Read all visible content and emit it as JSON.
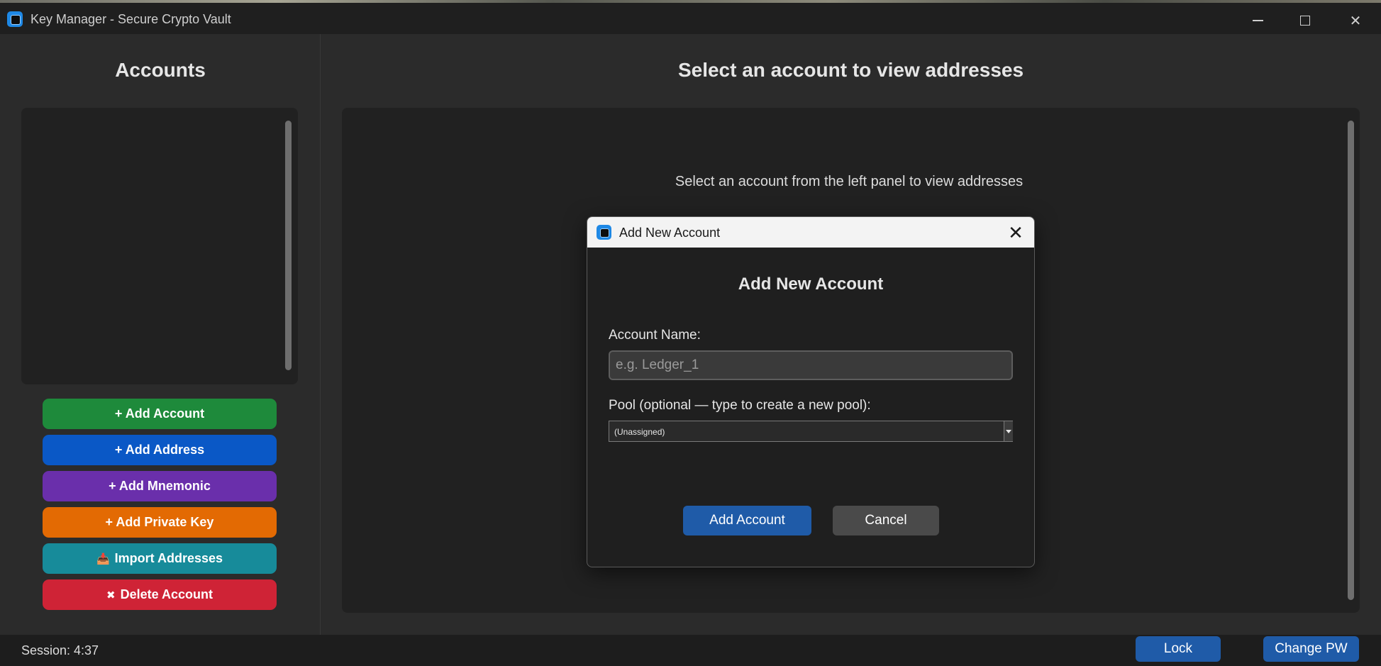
{
  "window": {
    "title": "Key Manager - Secure Crypto Vault",
    "minimize_glyph": "—",
    "maximize_glyph": "☐",
    "close_glyph": "✕"
  },
  "sidebar": {
    "title": "Accounts",
    "buttons": {
      "add_account": "+ Add Account",
      "add_address": "+ Add Address",
      "add_mnemonic": "+ Add Mnemonic",
      "add_private_key": "+ Add Private Key",
      "import_addresses": "Import Addresses",
      "import_icon_glyph": "📥",
      "delete_account": "Delete Account",
      "delete_icon_glyph": "✖"
    }
  },
  "main": {
    "title": "Select an account to view addresses",
    "hint": "Select an account from the left panel to view addresses"
  },
  "status": {
    "session": "Session: 4:37",
    "lock": "Lock",
    "change_pw": "Change PW"
  },
  "dialog": {
    "window_title": "Add New Account",
    "close_glyph": "✕",
    "heading": "Add New Account",
    "name_label": "Account Name:",
    "name_placeholder": "e.g. Ledger_1",
    "name_value": "",
    "pool_label": "Pool (optional — type to create a new pool):",
    "pool_value": "(Unassigned)",
    "add_button": "Add Account",
    "cancel_button": "Cancel"
  },
  "colors": {
    "accent_blue": "#1f5ba8",
    "green": "#1e8a3b",
    "blue": "#0a58c6",
    "purple": "#6a2fab",
    "orange": "#e36a03",
    "teal": "#178b9a",
    "red": "#cf2336"
  }
}
